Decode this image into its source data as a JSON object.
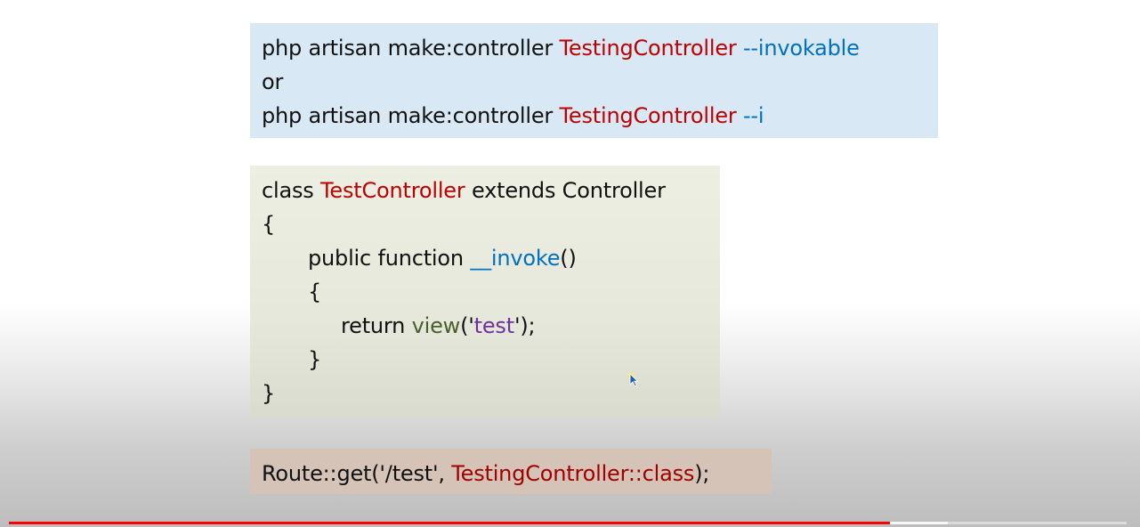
{
  "commands": {
    "line1": {
      "prefix": "php artisan make:controller ",
      "name": "TestingController",
      "flag": " --invokable"
    },
    "line2": {
      "text": "or"
    },
    "line3": {
      "prefix": "php artisan make:controller ",
      "name": "TestingController",
      "flag": " --i"
    }
  },
  "code": {
    "l1_kw": "class ",
    "l1_name": "TestController",
    "l1_rest": " extends Controller",
    "l2": "{",
    "l3_kw": "public function ",
    "l3_name": "__invoke",
    "l3_rest": "()",
    "l4": "{",
    "l5_kw": "return ",
    "l5_fn": "view",
    "l5_open": "('",
    "l5_str": "test",
    "l5_close": "');",
    "l6": "}",
    "l7": "}"
  },
  "route": {
    "prefix": "Route::get('/test', ",
    "name": "TestingController::class",
    "suffix": ");"
  },
  "player": {
    "progress": 0.788,
    "buffered": 0.84
  },
  "colors": {
    "accent_red": "#c00000",
    "accent_blue": "#0070c0",
    "progress_red": "#ff0000"
  }
}
